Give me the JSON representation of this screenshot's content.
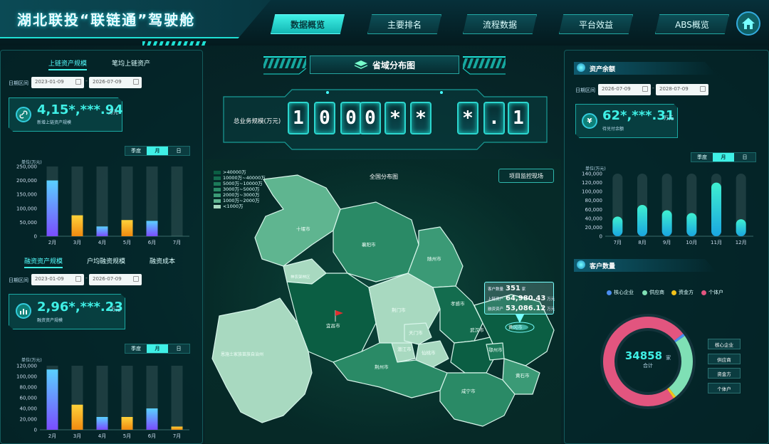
{
  "header": {
    "title": "湖北联投“联链通”驾驶舱",
    "nav": [
      "数据概览",
      "主要排名",
      "流程数据",
      "平台效益",
      "ABS概览"
    ],
    "active_nav": 0,
    "home_icon": "home-icon"
  },
  "left": {
    "top_tabs": [
      "上链资产规模",
      "笔均上链资产"
    ],
    "date_label": "日期区间",
    "date_from": "2023-01-09",
    "date_to": "2026-07-09",
    "metric_value": "4,15*,***.94",
    "metric_unit": "万元",
    "metric_caption": "新增上链资产规模",
    "period_tabs": [
      "季度",
      "月",
      "日"
    ],
    "unit_label": "单位(万元)",
    "chart1": {
      "type": "bar",
      "categories": [
        "2月",
        "3月",
        "4月",
        "5月",
        "6月",
        "7月"
      ],
      "values": [
        200000,
        75000,
        35000,
        58000,
        55000,
        0
      ],
      "ylim": [
        0,
        250000
      ],
      "yticks": [
        "250,000",
        "200,000",
        "150,000",
        "100,000",
        "50,000",
        "0"
      ],
      "colors": [
        "#7d6dff",
        "#f2a41a",
        "#6b7eff",
        "#f2a41a",
        "#6b7eff",
        "#f2a41a"
      ]
    },
    "bottom_tabs": [
      "融资资产规模",
      "户均融资规模",
      "融资成本"
    ],
    "date_from2": "2023-01-09",
    "date_to2": "2026-07-09",
    "metric2_value": "2,96*,***.23",
    "metric2_unit": "万元",
    "metric2_caption": "融资资产规模",
    "chart2": {
      "type": "bar",
      "categories": [
        "2月",
        "3月",
        "4月",
        "5月",
        "6月",
        "7月"
      ],
      "values": [
        113000,
        47000,
        24000,
        24000,
        40000,
        6000
      ],
      "ylim": [
        0,
        120000
      ],
      "yticks": [
        "120,000",
        "100,000",
        "80,000",
        "60,000",
        "40,000",
        "20,000",
        "0"
      ]
    }
  },
  "center": {
    "title": "省域分布图",
    "total_label": "总业务规模(万元)",
    "digits": [
      "1",
      "0",
      "0",
      "0",
      "*",
      "*",
      "*",
      ".",
      "1"
    ],
    "map_buttons": [
      "全国分布图",
      "项目监控现场"
    ],
    "legend": [
      ">40000万",
      "10000万~40000万",
      "5000万~10000万",
      "3000万~5000万",
      "2000万~3000万",
      "1000万~2000万",
      "<1000万"
    ],
    "legend_colors": [
      "#0b5e43",
      "#136c4e",
      "#1c7a59",
      "#2a8a66",
      "#3b9a76",
      "#5fb590",
      "#a8d9c0"
    ],
    "cities": {
      "shiyan": "十堰市",
      "xiangyang": "襄阳市",
      "suizhou": "随州市",
      "shennongjia": "神农架林区",
      "yichang": "宜昌市",
      "jingmen": "荆门市",
      "xiaogan": "孝感市",
      "enshi": "恩施土家族苗族自治州",
      "tianmen": "天门市",
      "qianjiang": "潜江市",
      "xiantao": "仙桃市",
      "wuhan": "武汉市",
      "huanggang": "黄冈市",
      "ezhou": "鄂州市",
      "jingzhou": "荆州市",
      "huangshi": "黄石市",
      "xianning": "咸宁市"
    },
    "tooltip": {
      "r1_label": "客户数量",
      "r1_value": "351",
      "r1_unit": "家",
      "r2_label": "上链资产",
      "r2_value": "64,980.43",
      "r2_unit": "万元",
      "r3_label": "融资资产",
      "r3_value": "53,086.12",
      "r3_unit": "万元"
    }
  },
  "right": {
    "title1": "资产余额",
    "date_label": "日期区间",
    "date_from": "2026-07-09",
    "date_to": "2028-07-09",
    "metric_value": "62*,***.31",
    "metric_unit": "万元",
    "metric_caption": "待兑付余额",
    "metric_icon": "yen-icon",
    "period_tabs": [
      "季度",
      "月",
      "日"
    ],
    "unit_label": "单位(万元)",
    "chart": {
      "type": "bar",
      "categories": [
        "7月",
        "8月",
        "9月",
        "10月",
        "11月",
        "12月"
      ],
      "values": [
        44000,
        70000,
        58000,
        52000,
        120000,
        38000
      ],
      "ylim": [
        0,
        140000
      ],
      "yticks": [
        "140,000",
        "120,000",
        "100,000",
        "80,000",
        "60,000",
        "40,000",
        "20,000",
        "0"
      ]
    },
    "title2": "客户数量",
    "donut": {
      "type": "pie",
      "legend": [
        "核心企业",
        "供应商",
        "资金方",
        "个体户"
      ],
      "colors": [
        "#4a8df0",
        "#7fe0b5",
        "#f2c21a",
        "#e2557f"
      ],
      "values": [
        1,
        24,
        1,
        74
      ],
      "total": "34858",
      "total_unit": "家",
      "total_caption": "合计"
    },
    "side_buttons": [
      "核心企业",
      "供应商",
      "资金方",
      "个体户"
    ]
  }
}
